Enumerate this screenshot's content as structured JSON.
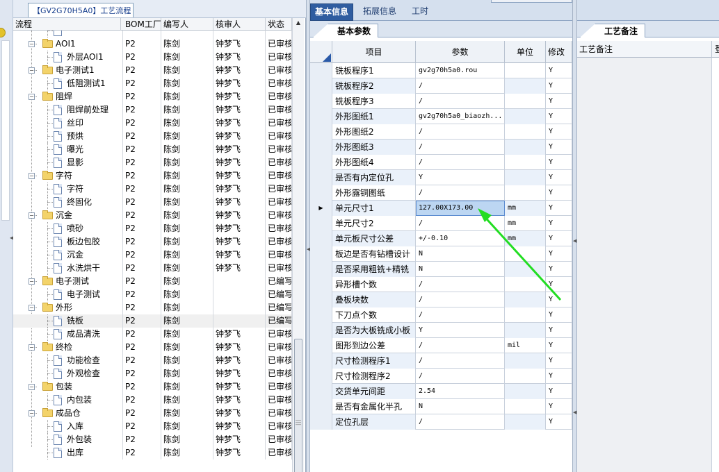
{
  "tree_tab": {
    "label": "【GV2G70H5A0】工艺流程"
  },
  "tree_columns": [
    "流程",
    "BOM工厂",
    "编写人",
    "核审人",
    "状态"
  ],
  "tree_rows": [
    {
      "name": "",
      "bom": "",
      "writer": "",
      "reviewer": "",
      "status": ""
    },
    {
      "name": "AOI1",
      "bom": "P2",
      "writer": "陈剑",
      "reviewer": "钟梦飞",
      "status": "已审核"
    },
    {
      "name": "外层AOI1",
      "bom": "P2",
      "writer": "陈剑",
      "reviewer": "钟梦飞",
      "status": "已审核"
    },
    {
      "name": "电子测试1",
      "bom": "P2",
      "writer": "陈剑",
      "reviewer": "钟梦飞",
      "status": "已审核"
    },
    {
      "name": "低阻测试1",
      "bom": "P2",
      "writer": "陈剑",
      "reviewer": "钟梦飞",
      "status": "已审核"
    },
    {
      "name": "阻焊",
      "bom": "P2",
      "writer": "陈剑",
      "reviewer": "钟梦飞",
      "status": "已审核"
    },
    {
      "name": "阻焊前处理",
      "bom": "P2",
      "writer": "陈剑",
      "reviewer": "钟梦飞",
      "status": "已审核"
    },
    {
      "name": "丝印",
      "bom": "P2",
      "writer": "陈剑",
      "reviewer": "钟梦飞",
      "status": "已审核"
    },
    {
      "name": "预烘",
      "bom": "P2",
      "writer": "陈剑",
      "reviewer": "钟梦飞",
      "status": "已审核"
    },
    {
      "name": "曝光",
      "bom": "P2",
      "writer": "陈剑",
      "reviewer": "钟梦飞",
      "status": "已审核"
    },
    {
      "name": "显影",
      "bom": "P2",
      "writer": "陈剑",
      "reviewer": "钟梦飞",
      "status": "已审核"
    },
    {
      "name": "字符",
      "bom": "P2",
      "writer": "陈剑",
      "reviewer": "钟梦飞",
      "status": "已审核"
    },
    {
      "name": "字符",
      "bom": "P2",
      "writer": "陈剑",
      "reviewer": "钟梦飞",
      "status": "已审核"
    },
    {
      "name": "终固化",
      "bom": "P2",
      "writer": "陈剑",
      "reviewer": "钟梦飞",
      "status": "已审核"
    },
    {
      "name": "沉金",
      "bom": "P2",
      "writer": "陈剑",
      "reviewer": "钟梦飞",
      "status": "已审核"
    },
    {
      "name": "喷砂",
      "bom": "P2",
      "writer": "陈剑",
      "reviewer": "钟梦飞",
      "status": "已审核"
    },
    {
      "name": "板边包胶",
      "bom": "P2",
      "writer": "陈剑",
      "reviewer": "钟梦飞",
      "status": "已审核"
    },
    {
      "name": "沉金",
      "bom": "P2",
      "writer": "陈剑",
      "reviewer": "钟梦飞",
      "status": "已审核"
    },
    {
      "name": "水洗烘干",
      "bom": "P2",
      "writer": "陈剑",
      "reviewer": "钟梦飞",
      "status": "已审核"
    },
    {
      "name": "电子测试",
      "bom": "P2",
      "writer": "陈剑",
      "reviewer": "",
      "status": "已编写"
    },
    {
      "name": "电子测试",
      "bom": "P2",
      "writer": "陈剑",
      "reviewer": "",
      "status": "已编写"
    },
    {
      "name": "外形",
      "bom": "P2",
      "writer": "陈剑",
      "reviewer": "",
      "status": "已编写"
    },
    {
      "name": "铣板",
      "bom": "P2",
      "writer": "陈剑",
      "reviewer": "",
      "status": "已编写"
    },
    {
      "name": "成品清洗",
      "bom": "P2",
      "writer": "陈剑",
      "reviewer": "钟梦飞",
      "status": "已审核"
    },
    {
      "name": "终检",
      "bom": "P2",
      "writer": "陈剑",
      "reviewer": "钟梦飞",
      "status": "已审核"
    },
    {
      "name": "功能检查",
      "bom": "P2",
      "writer": "陈剑",
      "reviewer": "钟梦飞",
      "status": "已审核"
    },
    {
      "name": "外观检查",
      "bom": "P2",
      "writer": "陈剑",
      "reviewer": "钟梦飞",
      "status": "已审核"
    },
    {
      "name": "包装",
      "bom": "P2",
      "writer": "陈剑",
      "reviewer": "钟梦飞",
      "status": "已审核"
    },
    {
      "name": "内包装",
      "bom": "P2",
      "writer": "陈剑",
      "reviewer": "钟梦飞",
      "status": "已审核"
    },
    {
      "name": "成品仓",
      "bom": "P2",
      "writer": "陈剑",
      "reviewer": "钟梦飞",
      "status": "已审核"
    },
    {
      "name": "入库",
      "bom": "P2",
      "writer": "陈剑",
      "reviewer": "钟梦飞",
      "status": "已审核"
    },
    {
      "name": "外包装",
      "bom": "P2",
      "writer": "陈剑",
      "reviewer": "钟梦飞",
      "status": "已审核"
    },
    {
      "name": "出库",
      "bom": "P2",
      "writer": "陈剑",
      "reviewer": "钟梦飞",
      "status": "已审核"
    }
  ],
  "main_tabs": [
    "基本信息",
    "拓展信息",
    "工时"
  ],
  "sub_tab_a": "基本参数",
  "sub_tab_b": "工艺备注",
  "grid_columns": [
    "项目",
    "参数",
    "单位",
    "修改"
  ],
  "grid_rows": [
    {
      "item": "铣板程序1",
      "param": "gv2g70h5a0.rou",
      "unit": "",
      "mod": "Y"
    },
    {
      "item": "铣板程序2",
      "param": "/",
      "unit": "",
      "mod": "Y"
    },
    {
      "item": "铣板程序3",
      "param": "/",
      "unit": "",
      "mod": "Y"
    },
    {
      "item": "外形图纸1",
      "param": "gv2g70h5a0_biaozh...",
      "unit": "",
      "mod": "Y"
    },
    {
      "item": "外形图纸2",
      "param": "/",
      "unit": "",
      "mod": "Y"
    },
    {
      "item": "外形图纸3",
      "param": "/",
      "unit": "",
      "mod": "Y"
    },
    {
      "item": "外形图纸4",
      "param": "/",
      "unit": "",
      "mod": "Y"
    },
    {
      "item": "是否有内定位孔",
      "param": "Y",
      "unit": "",
      "mod": "Y"
    },
    {
      "item": "外形露铜图纸",
      "param": "/",
      "unit": "",
      "mod": "Y"
    },
    {
      "item": "单元尺寸1",
      "param": "127.00X173.00",
      "unit": "mm",
      "mod": "Y"
    },
    {
      "item": "单元尺寸2",
      "param": "/",
      "unit": "mm",
      "mod": "Y"
    },
    {
      "item": "单元板尺寸公差",
      "param": "+/-0.10",
      "unit": "mm",
      "mod": "Y"
    },
    {
      "item": "板边是否有钻槽设计",
      "param": "N",
      "unit": "",
      "mod": "Y"
    },
    {
      "item": "是否采用粗铣+精铣",
      "param": "N",
      "unit": "",
      "mod": "Y"
    },
    {
      "item": "异形槽个数",
      "param": "/",
      "unit": "",
      "mod": "Y"
    },
    {
      "item": "叠板块数",
      "param": "/",
      "unit": "",
      "mod": "Y"
    },
    {
      "item": "下刀点个数",
      "param": "/",
      "unit": "",
      "mod": "Y"
    },
    {
      "item": "是否为大板铣成小板",
      "param": "Y",
      "unit": "",
      "mod": "Y"
    },
    {
      "item": "图形到边公差",
      "param": "/",
      "unit": "mil",
      "mod": "Y"
    },
    {
      "item": "尺寸检测程序1",
      "param": "/",
      "unit": "",
      "mod": "Y"
    },
    {
      "item": "尺寸检测程序2",
      "param": "/",
      "unit": "",
      "mod": "Y"
    },
    {
      "item": "交货单元间距",
      "param": "2.54",
      "unit": "",
      "mod": "Y"
    },
    {
      "item": "是否有金属化半孔",
      "param": "N",
      "unit": "",
      "mod": "Y"
    },
    {
      "item": "定位孔层",
      "param": "/",
      "unit": "",
      "mod": "Y"
    }
  ],
  "remark_columns": [
    "工艺备注",
    "登"
  ],
  "colors": {
    "arrow": "#22dd22",
    "tab_active": "#2f5da0",
    "selected_cell": "#bcd6f2"
  }
}
